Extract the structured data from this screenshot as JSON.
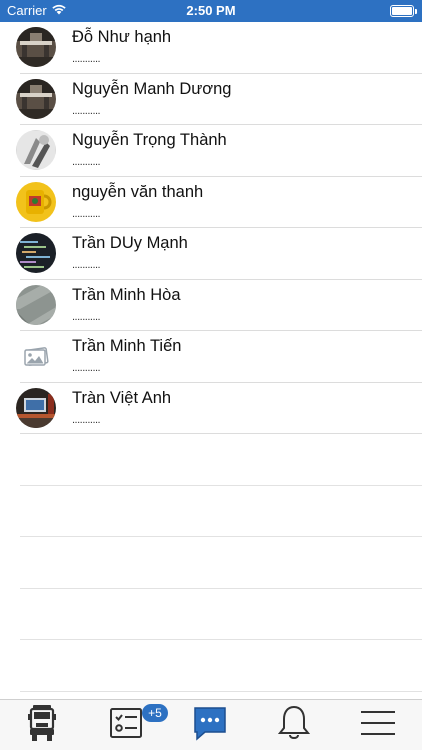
{
  "status_bar": {
    "carrier": "Carrier",
    "time": "2:50 PM"
  },
  "contacts": [
    {
      "name": "Đỗ Như hạnh",
      "subtitle": "...........",
      "avatar": "photo-room"
    },
    {
      "name": "Nguyễn Manh Dương",
      "subtitle": "...........",
      "avatar": "photo-room"
    },
    {
      "name": "Nguyễn Trọng Thành",
      "subtitle": "...........",
      "avatar": "photo-grayscale"
    },
    {
      "name": "nguyễn văn thanh",
      "subtitle": "...........",
      "avatar": "photo-mug"
    },
    {
      "name": "Trần DUy Mạnh",
      "subtitle": "...........",
      "avatar": "photo-code-screen"
    },
    {
      "name": "Trần Minh Hòa",
      "subtitle": "...........",
      "avatar": "photo-tiles"
    },
    {
      "name": "Trần Minh Tiến",
      "subtitle": "...........",
      "avatar": "image-placeholder-icon"
    },
    {
      "name": "Tràn Việt Anh",
      "subtitle": "...........",
      "avatar": "photo-desk"
    }
  ],
  "tab_bar": {
    "tabs": [
      {
        "name": "truck-icon",
        "active": false
      },
      {
        "name": "checklist-icon",
        "active": false,
        "badge": "+5"
      },
      {
        "name": "chat-icon",
        "active": true
      },
      {
        "name": "bell-icon",
        "active": false
      },
      {
        "name": "menu-icon",
        "active": false
      }
    ]
  },
  "colors": {
    "accent": "#2d71c2",
    "tab_icon": "#333333",
    "divider": "#dcdcdc"
  }
}
